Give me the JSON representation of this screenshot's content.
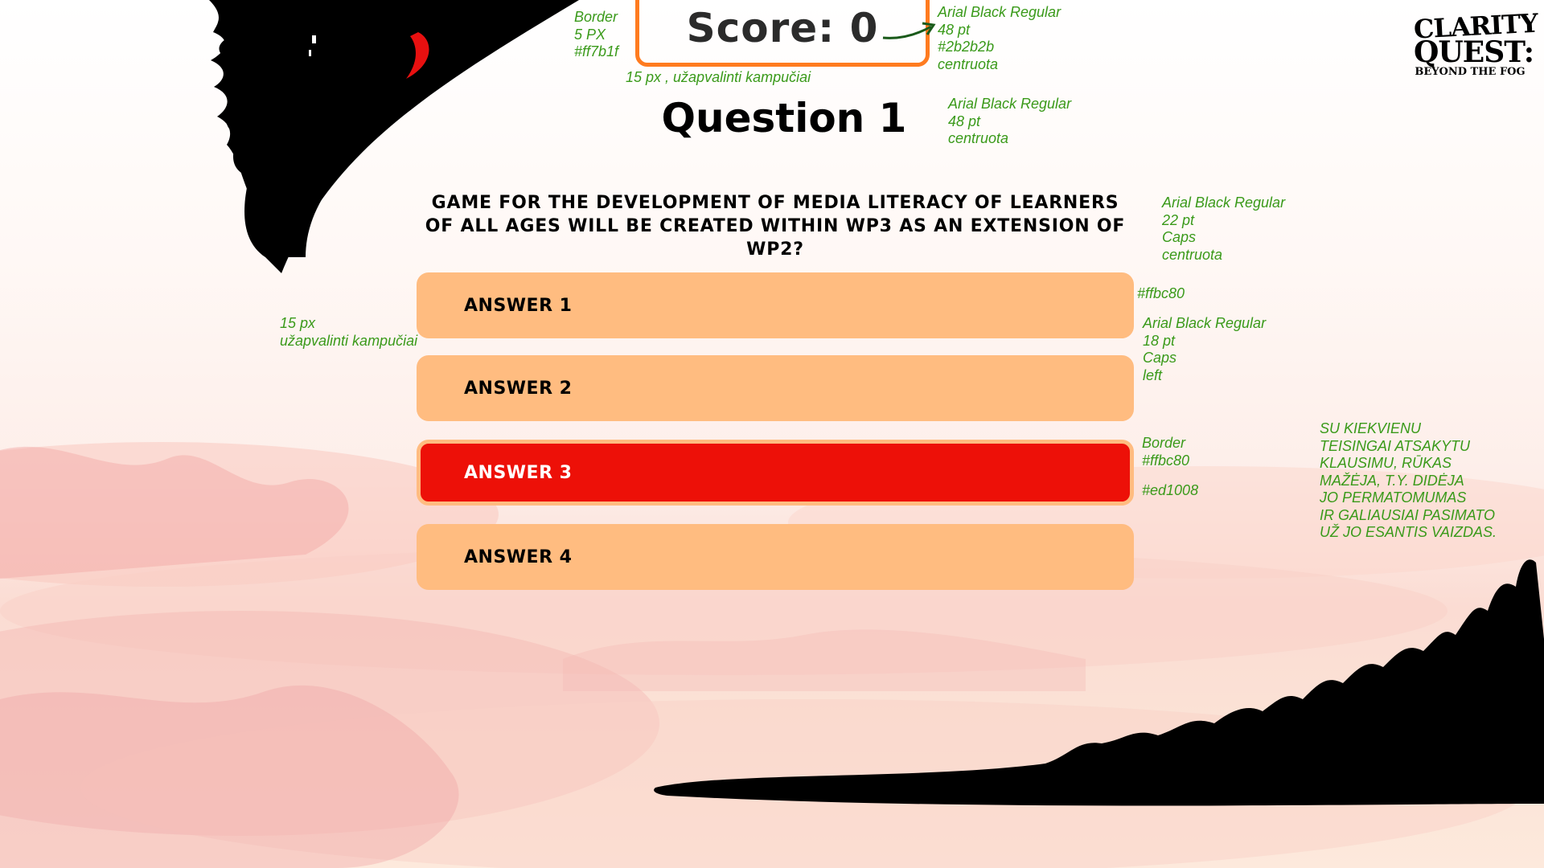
{
  "score": {
    "label": "Score: 0",
    "border_color": "#ff7b1f",
    "text_color": "#2b2b2b"
  },
  "question": {
    "title": "Question 1",
    "text": "GAME FOR THE DEVELOPMENT OF MEDIA LITERACY OF LEARNERS OF ALL AGES WILL BE CREATED WITHIN WP3 AS AN EXTENSION OF WP2?"
  },
  "answers": [
    {
      "label": "ANSWER 1",
      "selected": false
    },
    {
      "label": "ANSWER 2",
      "selected": false
    },
    {
      "label": "ANSWER 3",
      "selected": true
    },
    {
      "label": "ANSWER 4",
      "selected": false
    }
  ],
  "colors": {
    "answer_bg": "#ffbc80",
    "answer_selected_bg": "#ed1008",
    "annotation": "#3a9a1a"
  },
  "logo": {
    "line1": "CLARITY",
    "line2": "QUEST:",
    "line3": "BEYOND THE FOG"
  },
  "annotations": {
    "score_border": "Border\n5 PX\n#ff7b1f",
    "score_font": "Arial Black Regular\n48 pt\n#2b2b2b\ncentruota",
    "score_corners": "15 px , užapvalinti kampučiai",
    "title_font": "Arial Black Regular\n48 pt\ncentruota",
    "question_font": "Arial Black Regular\n22 pt\nCaps\ncentruota",
    "answer_color": "#ffbc80",
    "answer_font": "Arial Black Regular\n18 pt\nCaps\nleft",
    "answer_corners": "15 px\nužapvalinti kampučiai",
    "selected_border": "Border\n#ffbc80",
    "selected_color": "#ed1008",
    "fog_note": "SU KIEKVIENU\nTEISINGAI ATSAKYTU\nKLAUSIMU, RŪKAS\nMAŽĖJA, T.Y. DIDĖJA\nJO PERMATOMUMAS\nIR GALIAUSIAI PASIMATO\nUŽ JO ESANTIS VAIZDAS."
  }
}
